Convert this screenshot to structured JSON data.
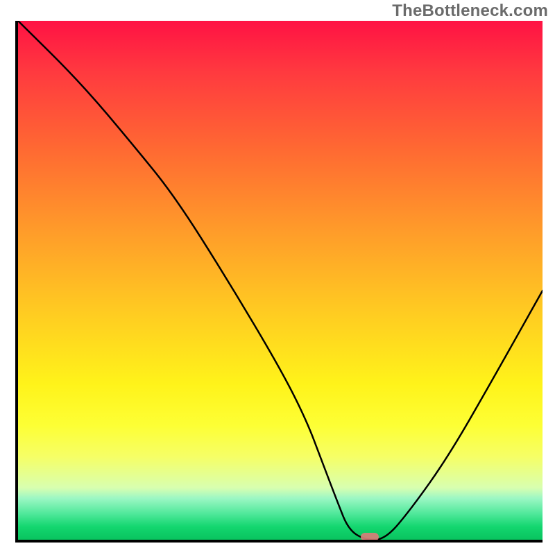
{
  "watermark": "TheBottleneck.com",
  "chart_data": {
    "type": "line",
    "title": "",
    "xlabel": "",
    "ylabel": "",
    "xlim": [
      0,
      100
    ],
    "ylim": [
      0,
      100
    ],
    "series": [
      {
        "name": "bottleneck-curve",
        "x": [
          0,
          12,
          22,
          30,
          40,
          50,
          55,
          58,
          61,
          63,
          66,
          70,
          75,
          82,
          90,
          100
        ],
        "y": [
          100,
          88,
          76,
          66,
          50,
          33,
          23,
          15,
          7,
          2,
          0,
          0,
          6,
          16,
          30,
          48
        ]
      }
    ],
    "marker": {
      "x": 67,
      "y": 0
    },
    "background_gradient": {
      "top": "#ff1244",
      "mid": "#fff31a",
      "bottom": "#09c45f"
    }
  }
}
